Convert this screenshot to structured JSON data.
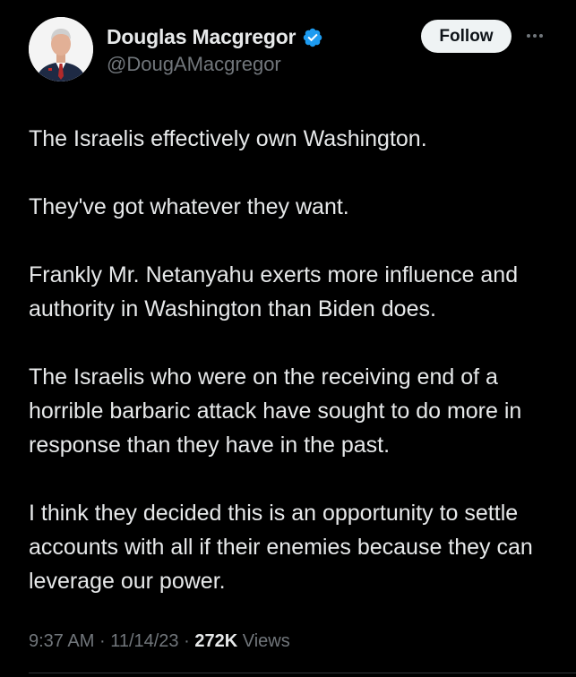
{
  "author": {
    "display_name": "Douglas Macgregor",
    "handle": "@DougAMacgregor",
    "verified": true,
    "verified_color": "#1d9bf0"
  },
  "actions": {
    "follow_label": "Follow",
    "more_icon": "more-horizontal-icon"
  },
  "tweet": {
    "paragraphs": [
      "The Israelis effectively own Washington.",
      "They've got whatever they want.",
      "Frankly Mr. Netanyahu exerts more influence and authority in Washington than Biden does.",
      "The Israelis who were on the receiving end of a horrible barbaric attack have sought to do more in response than they have in the past.",
      "I think they decided this is an opportunity to settle accounts with all if their enemies because they can leverage our power."
    ]
  },
  "meta": {
    "time": "9:37 AM",
    "date": "11/14/23",
    "views_count": "272K",
    "views_label": "Views",
    "separator": "·"
  },
  "colors": {
    "background": "#000000",
    "text_primary": "#e7e9ea",
    "text_secondary": "#71767b",
    "follow_bg": "#eff3f4"
  }
}
